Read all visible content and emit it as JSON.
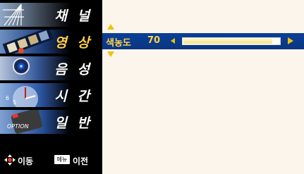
{
  "menu": {
    "items": [
      {
        "label": "채 널",
        "icon": "antenna-icon"
      },
      {
        "label": "영 상",
        "icon": "film-icon",
        "active": true
      },
      {
        "label": "음 성",
        "icon": "speaker-icon"
      },
      {
        "label": "시 간",
        "icon": "clock-icon"
      },
      {
        "label": "일 반",
        "icon": "option-icon",
        "thumb_text": "OPTION"
      }
    ],
    "nav_hint": {
      "move_label": "이동",
      "menu_key": "메뉴",
      "back_label": "이전"
    }
  },
  "setting": {
    "name": "색농도",
    "value": "70",
    "level_fraction": 0.93
  },
  "colors": {
    "highlight_text": "#ffd34a",
    "row_bg": "#0a3f98",
    "arrow": "#f0c200"
  }
}
